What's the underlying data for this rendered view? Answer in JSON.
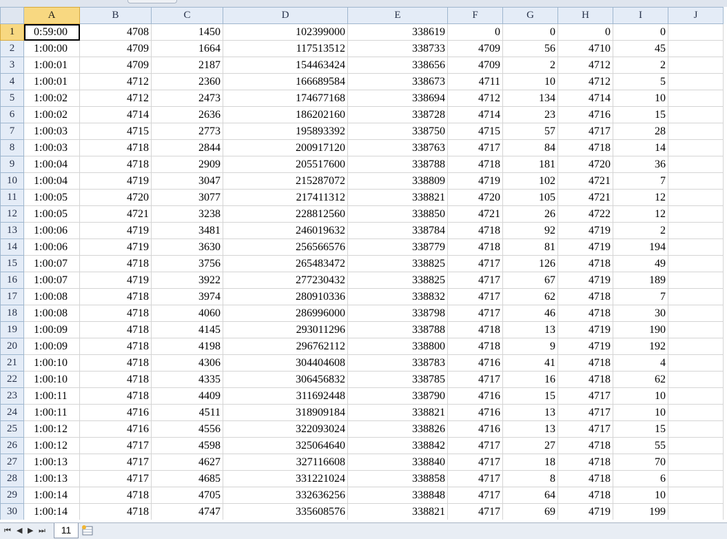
{
  "columns": [
    "A",
    "B",
    "C",
    "D",
    "E",
    "F",
    "G",
    "H",
    "I",
    "J"
  ],
  "rows": [
    [
      "0:59:00",
      "4708",
      "1450",
      "102399000",
      "338619",
      "0",
      "0",
      "0",
      "0",
      ""
    ],
    [
      "1:00:00",
      "4709",
      "1664",
      "117513512",
      "338733",
      "4709",
      "56",
      "4710",
      "45",
      ""
    ],
    [
      "1:00:01",
      "4709",
      "2187",
      "154463424",
      "338656",
      "4709",
      "2",
      "4712",
      "2",
      ""
    ],
    [
      "1:00:01",
      "4712",
      "2360",
      "166689584",
      "338673",
      "4711",
      "10",
      "4712",
      "5",
      ""
    ],
    [
      "1:00:02",
      "4712",
      "2473",
      "174677168",
      "338694",
      "4712",
      "134",
      "4714",
      "10",
      ""
    ],
    [
      "1:00:02",
      "4714",
      "2636",
      "186202160",
      "338728",
      "4714",
      "23",
      "4716",
      "15",
      ""
    ],
    [
      "1:00:03",
      "4715",
      "2773",
      "195893392",
      "338750",
      "4715",
      "57",
      "4717",
      "28",
      ""
    ],
    [
      "1:00:03",
      "4718",
      "2844",
      "200917120",
      "338763",
      "4717",
      "84",
      "4718",
      "14",
      ""
    ],
    [
      "1:00:04",
      "4718",
      "2909",
      "205517600",
      "338788",
      "4718",
      "181",
      "4720",
      "36",
      ""
    ],
    [
      "1:00:04",
      "4719",
      "3047",
      "215287072",
      "338809",
      "4719",
      "102",
      "4721",
      "7",
      ""
    ],
    [
      "1:00:05",
      "4720",
      "3077",
      "217411312",
      "338821",
      "4720",
      "105",
      "4721",
      "12",
      ""
    ],
    [
      "1:00:05",
      "4721",
      "3238",
      "228812560",
      "338850",
      "4721",
      "26",
      "4722",
      "12",
      ""
    ],
    [
      "1:00:06",
      "4719",
      "3481",
      "246019632",
      "338784",
      "4718",
      "92",
      "4719",
      "2",
      ""
    ],
    [
      "1:00:06",
      "4719",
      "3630",
      "256566576",
      "338779",
      "4718",
      "81",
      "4719",
      "194",
      ""
    ],
    [
      "1:00:07",
      "4718",
      "3756",
      "265483472",
      "338825",
      "4717",
      "126",
      "4718",
      "49",
      ""
    ],
    [
      "1:00:07",
      "4719",
      "3922",
      "277230432",
      "338825",
      "4717",
      "67",
      "4719",
      "189",
      ""
    ],
    [
      "1:00:08",
      "4718",
      "3974",
      "280910336",
      "338832",
      "4717",
      "62",
      "4718",
      "7",
      ""
    ],
    [
      "1:00:08",
      "4718",
      "4060",
      "286996000",
      "338798",
      "4717",
      "46",
      "4718",
      "30",
      ""
    ],
    [
      "1:00:09",
      "4718",
      "4145",
      "293011296",
      "338788",
      "4718",
      "13",
      "4719",
      "190",
      ""
    ],
    [
      "1:00:09",
      "4718",
      "4198",
      "296762112",
      "338800",
      "4718",
      "9",
      "4719",
      "192",
      ""
    ],
    [
      "1:00:10",
      "4718",
      "4306",
      "304404608",
      "338783",
      "4716",
      "41",
      "4718",
      "4",
      ""
    ],
    [
      "1:00:10",
      "4718",
      "4335",
      "306456832",
      "338785",
      "4717",
      "16",
      "4718",
      "62",
      ""
    ],
    [
      "1:00:11",
      "4718",
      "4409",
      "311692448",
      "338790",
      "4716",
      "15",
      "4717",
      "10",
      ""
    ],
    [
      "1:00:11",
      "4716",
      "4511",
      "318909184",
      "338821",
      "4716",
      "13",
      "4717",
      "10",
      ""
    ],
    [
      "1:00:12",
      "4716",
      "4556",
      "322093024",
      "338826",
      "4716",
      "13",
      "4717",
      "15",
      ""
    ],
    [
      "1:00:12",
      "4717",
      "4598",
      "325064640",
      "338842",
      "4717",
      "27",
      "4718",
      "55",
      ""
    ],
    [
      "1:00:13",
      "4717",
      "4627",
      "327116608",
      "338840",
      "4717",
      "18",
      "4718",
      "70",
      ""
    ],
    [
      "1:00:13",
      "4717",
      "4685",
      "331221024",
      "338858",
      "4717",
      "8",
      "4718",
      "6",
      ""
    ],
    [
      "1:00:14",
      "4718",
      "4705",
      "332636256",
      "338848",
      "4717",
      "64",
      "4718",
      "10",
      ""
    ],
    [
      "1:00:14",
      "4718",
      "4747",
      "335608576",
      "338821",
      "4717",
      "69",
      "4719",
      "199",
      ""
    ]
  ],
  "selected_column": "A",
  "selected_row": 1,
  "sheet_tab": "11",
  "nav_icons": [
    "first-sheet-icon",
    "prev-sheet-icon",
    "next-sheet-icon",
    "last-sheet-icon"
  ],
  "colors": {
    "header_bg": "#e4ecf7",
    "selected_header": "#f8d881",
    "gridline": "#d4d4d4"
  }
}
